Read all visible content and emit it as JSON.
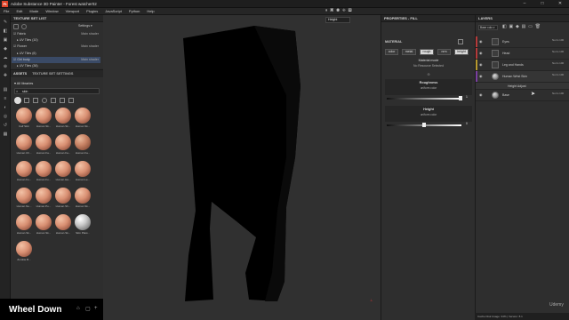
{
  "app": {
    "title": "Adobe Substance 3D Painter - Forest watcher02",
    "logo": "Pt"
  },
  "window": {
    "minimize": "–",
    "maximize": "□",
    "close": "✕"
  },
  "menu": [
    "File",
    "Edit",
    "Mode",
    "Window",
    "Viewport",
    "Plugins",
    "JavaScript",
    "Python",
    "Help"
  ],
  "texture_set_list": {
    "title": "TEXTURE SET LIST",
    "settings": "Settings ▾",
    "rows": [
      {
        "name": "Fabric",
        "shader": "Main shader",
        "level": 0
      },
      {
        "name": "UV Tiles (10)",
        "shader": "",
        "level": 1
      },
      {
        "name": "Flower",
        "shader": "Main shader",
        "level": 0
      },
      {
        "name": "UV Tiles (6)",
        "shader": "",
        "level": 1
      },
      {
        "name": "Girl body",
        "shader": "Main shader",
        "level": 0,
        "selected": true
      },
      {
        "name": "UV Tiles (38)",
        "shader": "",
        "level": 1
      }
    ]
  },
  "assets": {
    "tabs": [
      "ASSETS",
      "TEXTURE SET SETTINGS"
    ],
    "all_libraries": "All libraries",
    "search": "skin",
    "items": [
      {
        "label": "Calf Skin",
        "kind": "skin"
      },
      {
        "label": "Human Sk...",
        "kind": "skin"
      },
      {
        "label": "Human Sk...",
        "kind": "skin"
      },
      {
        "label": "Human Sk...",
        "kind": "skin"
      },
      {
        "label": "Human Ch...",
        "kind": "skin"
      },
      {
        "label": "Human Fa...",
        "kind": "skin"
      },
      {
        "label": "Human Fa...",
        "kind": "skin"
      },
      {
        "label": "Human Fa...",
        "kind": "rough"
      },
      {
        "label": "Human Fo...",
        "kind": "skin"
      },
      {
        "label": "Human Fo...",
        "kind": "skin"
      },
      {
        "label": "Human Ha...",
        "kind": "skin"
      },
      {
        "label": "Human Le...",
        "kind": "skin"
      },
      {
        "label": "Human Ne...",
        "kind": "skin"
      },
      {
        "label": "Human Po...",
        "kind": "skin"
      },
      {
        "label": "Human Sh...",
        "kind": "skin"
      },
      {
        "label": "Human Sk...",
        "kind": "skin"
      },
      {
        "label": "Human Sk...",
        "kind": "skin"
      },
      {
        "label": "Human Sk...",
        "kind": "skin"
      },
      {
        "label": "Human Sk...",
        "kind": "skin"
      },
      {
        "label": "Skin Plast...",
        "kind": "grey"
      },
      {
        "label": "Zombie B...",
        "kind": "skin"
      }
    ]
  },
  "overlay": {
    "text": "Wheel Down"
  },
  "viewport": {
    "channel": "Height"
  },
  "properties": {
    "title": "PROPERTIES - FILL",
    "material_label": "MATERIAL",
    "channels": [
      {
        "label": "color",
        "on": false
      },
      {
        "label": "metal",
        "on": false
      },
      {
        "label": "rough",
        "on": true
      },
      {
        "label": "nrm",
        "on": false
      },
      {
        "label": "height",
        "on": true
      }
    ],
    "material_mode": "Material mode",
    "no_resource": "No Resource Selected",
    "roughness": {
      "label": "Roughness",
      "sub": "uniform color",
      "value": "1"
    },
    "height": {
      "label": "Height",
      "sub": "uniform color",
      "value": "0"
    }
  },
  "layers": {
    "title": "LAYERS",
    "channel": "Base colo ▾",
    "rows": [
      {
        "name": "Eyes",
        "opacity": "Norm 100",
        "color": "#b53a3a"
      },
      {
        "name": "Head",
        "opacity": "Norm 100",
        "color": "#b53a3a"
      },
      {
        "name": "Leg and Hands",
        "opacity": "Norm 100",
        "color": "#b89a2f"
      },
      {
        "name": "Human Wrist Skin",
        "opacity": "Norm 100",
        "color": "#7a3fa0"
      },
      {
        "name": "Height Adjust",
        "opacity": "",
        "color": ""
      },
      {
        "name": "Base",
        "opacity": "Norm 100",
        "color": ""
      }
    ]
  },
  "status": {
    "cache": "Cache Disk Usage:",
    "mem": "34% | Version: 8.1"
  },
  "watermark": "Udemy"
}
